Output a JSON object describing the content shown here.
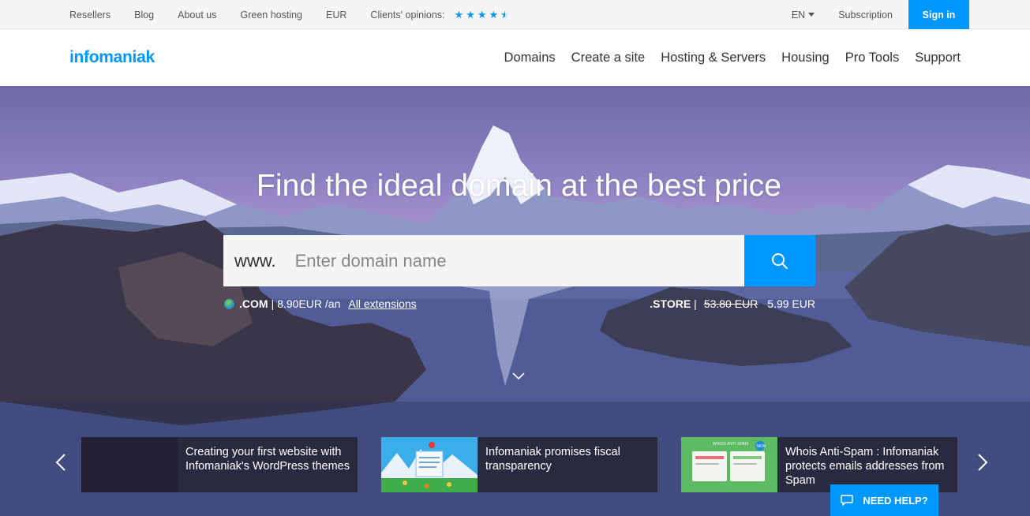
{
  "topbar": {
    "links": [
      "Resellers",
      "Blog",
      "About us",
      "Green hosting",
      "EUR"
    ],
    "opinions_label": "Clients' opinions:",
    "rating": 4.5,
    "language": "EN",
    "subscription": "Subscription",
    "sign_in": "Sign in"
  },
  "header": {
    "logo": "infomaniak",
    "nav": [
      "Domains",
      "Create a site",
      "Hosting & Servers",
      "Housing",
      "Pro Tools",
      "Support"
    ]
  },
  "hero": {
    "title": "Find the ideal domain at the best price",
    "search": {
      "prefix": "www.",
      "placeholder": "Enter domain name"
    },
    "promo_left": {
      "ext": ".COM",
      "price": "8.90EUR /an",
      "link": "All extensions"
    },
    "promo_right": {
      "ext": ".STORE",
      "old_price": "53.80 EUR",
      "new_price": "5.99 EUR"
    }
  },
  "news": [
    {
      "title": "Creating your first website with Infomaniak's WordPress themes"
    },
    {
      "title": "Infomaniak promises fiscal transparency"
    },
    {
      "title": "Whois Anti-Spam : Infomaniak protects emails addresses from Spam",
      "thumb_label": "WHOIS ANTI-SPAM",
      "badge": "NEW"
    }
  ],
  "help": "NEED HELP?",
  "colors": {
    "accent": "#0098ff"
  }
}
